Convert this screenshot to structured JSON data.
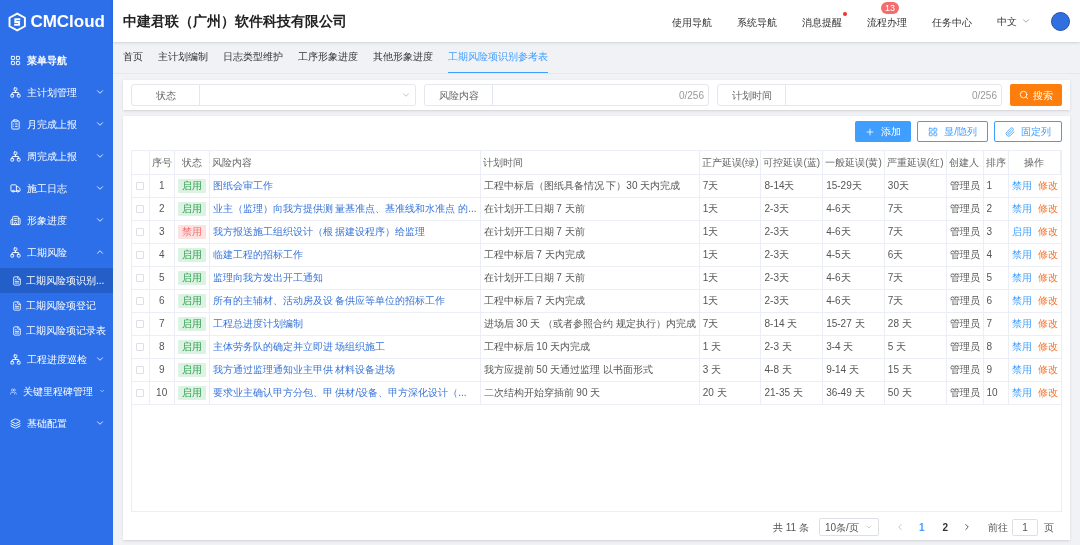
{
  "logo": "CMCloud",
  "company": "中建君联（广州）软件科技有限公司",
  "top_nav": [
    {
      "label": "使用导航",
      "dot": false
    },
    {
      "label": "系统导航",
      "dot": false
    },
    {
      "label": "消息提醒",
      "dot": true
    },
    {
      "label": "流程办理",
      "dot": false,
      "badge": "13"
    },
    {
      "label": "任务中心",
      "dot": false
    }
  ],
  "language": "中文",
  "sidebar": {
    "items": [
      {
        "label": "菜单导航"
      },
      {
        "label": "主计划管理",
        "expanded": false
      },
      {
        "label": "月完成上报",
        "expanded": false
      },
      {
        "label": "周完成上报",
        "expanded": false
      },
      {
        "label": "施工日志",
        "expanded": false
      },
      {
        "label": "形象进度",
        "expanded": false
      },
      {
        "label": "工期风险",
        "expanded": true,
        "children": [
          {
            "label": "工期风险项识别...",
            "selected": true
          },
          {
            "label": "工期风险项登记",
            "selected": false
          },
          {
            "label": "工期风险项记录表",
            "selected": false
          }
        ]
      },
      {
        "label": "工程进度巡检",
        "expanded": false
      },
      {
        "label": "关键里程碑管理",
        "expanded": false
      },
      {
        "label": "基础配置",
        "expanded": false
      }
    ]
  },
  "tabs": [
    {
      "label": "首页",
      "selected": false
    },
    {
      "label": "主计划编制",
      "selected": false
    },
    {
      "label": "日志类型维护",
      "selected": false
    },
    {
      "label": "工序形象进度",
      "selected": false
    },
    {
      "label": "其他形象进度",
      "selected": false
    },
    {
      "label": "工期风险项识别参考表",
      "selected": true
    }
  ],
  "filters": [
    {
      "kind": "select",
      "label": "状态"
    },
    {
      "kind": "text",
      "label": "风险内容",
      "counter": "0/256"
    },
    {
      "kind": "text",
      "label": "计划时间",
      "counter": "0/256"
    }
  ],
  "search_button": "搜索",
  "toolbar": [
    {
      "kind": "primary",
      "label": "添加"
    },
    {
      "kind": "columns",
      "label": "显/隐列"
    },
    {
      "kind": "pin",
      "label": "固定列"
    }
  ],
  "table": {
    "columns": [
      "序号",
      "状态",
      "风险内容",
      "计划时间",
      "正产延误(绿)",
      "可控延误(蓝)",
      "一般延误(黄)",
      "严重延误(红)",
      "创建人",
      "排序",
      "操作"
    ],
    "rows": [
      {
        "checked": false,
        "no": "1",
        "status": "启用",
        "enabled": true,
        "risk": "图纸会审工作",
        "plan": "工程中标后（图纸具备情况 下）30 天内完成",
        "green": "7天",
        "blue": "8-14天",
        "yellow": "15-29天",
        "red": "30天",
        "creator": "管理员",
        "order": "1",
        "toggle": "禁用",
        "edit": "修改"
      },
      {
        "checked": false,
        "no": "2",
        "status": "启用",
        "enabled": true,
        "risk": "业主（监理）向我方提供测 量基准点、基准线和水准点 的...",
        "plan": "在计划开工日期 7 天前",
        "green": "1天",
        "blue": "2-3天",
        "yellow": "4-6天",
        "red": "7天",
        "creator": "管理员",
        "order": "2",
        "toggle": "禁用",
        "edit": "修改"
      },
      {
        "checked": false,
        "no": "3",
        "status": "禁用",
        "enabled": false,
        "risk": "我方报送施工组织设计（根 据建设程序）给监理",
        "plan": "在计划开工日期 7 天前",
        "green": "1天",
        "blue": "2-3天",
        "yellow": "4-6天",
        "red": "7天",
        "creator": "管理员",
        "order": "3",
        "toggle": "启用",
        "edit": "修改"
      },
      {
        "checked": false,
        "no": "4",
        "status": "启用",
        "enabled": true,
        "risk": "临建工程的招标工作",
        "plan": "工程中标后 7 天内完成",
        "green": "1天",
        "blue": "2-3天",
        "yellow": "4-5天",
        "red": "6天",
        "creator": "管理员",
        "order": "4",
        "toggle": "禁用",
        "edit": "修改"
      },
      {
        "checked": false,
        "no": "5",
        "status": "启用",
        "enabled": true,
        "risk": "监理向我方发出开工通知",
        "plan": "在计划开工日期 7 天前",
        "green": "1天",
        "blue": "2-3天",
        "yellow": "4-6天",
        "red": "7天",
        "creator": "管理员",
        "order": "5",
        "toggle": "禁用",
        "edit": "修改"
      },
      {
        "checked": false,
        "no": "6",
        "status": "启用",
        "enabled": true,
        "risk": "所有的主辅材、活动房及设 备供应等单位的招标工作",
        "plan": "工程中标后 7 天内完成",
        "green": "1天",
        "blue": "2-3天",
        "yellow": "4-6天",
        "red": "7天",
        "creator": "管理员",
        "order": "6",
        "toggle": "禁用",
        "edit": "修改"
      },
      {
        "checked": false,
        "no": "7",
        "status": "启用",
        "enabled": true,
        "risk": "工程总进度计划编制",
        "plan": "进场后 30 天 （或者参照合约 规定执行）内完成",
        "green": "7天",
        "blue": "8-14 天",
        "yellow": "15-27 天",
        "red": "28 天",
        "creator": "管理员",
        "order": "7",
        "toggle": "禁用",
        "edit": "修改"
      },
      {
        "checked": false,
        "no": "8",
        "status": "启用",
        "enabled": true,
        "risk": "主体劳务队的确定并立即进 场组织施工",
        "plan": "工程中标后 10 天内完成",
        "green": "1 天",
        "blue": "2-3 天",
        "yellow": "3-4 天",
        "red": "5 天",
        "creator": "管理员",
        "order": "8",
        "toggle": "禁用",
        "edit": "修改"
      },
      {
        "checked": false,
        "no": "9",
        "status": "启用",
        "enabled": true,
        "risk": "我方通过监理通知业主甲供 材料设备进场",
        "plan": "我方应提前 50 天通过监理 以书面形式",
        "green": "3 天",
        "blue": "4-8 天",
        "yellow": "9-14 天",
        "red": "15 天",
        "creator": "管理员",
        "order": "9",
        "toggle": "禁用",
        "edit": "修改"
      },
      {
        "checked": false,
        "no": "10",
        "status": "启用",
        "enabled": true,
        "risk": "要求业主确认甲方分包、甲 供材/设备、甲方深化设计（...",
        "plan": "二次结构开始穿插前 90 天",
        "green": "20 天",
        "blue": "21-35 天",
        "yellow": "36-49 天",
        "red": "50 天",
        "creator": "管理员",
        "order": "10",
        "toggle": "禁用",
        "edit": "修改"
      }
    ]
  },
  "pagination": {
    "total": "共 11 条",
    "page_size": "10条/页",
    "pages": [
      {
        "label": "1",
        "selected": true
      },
      {
        "label": "2",
        "selected": false
      }
    ],
    "goto_label": "前往",
    "goto_value": "1",
    "goto_suffix": "页"
  }
}
